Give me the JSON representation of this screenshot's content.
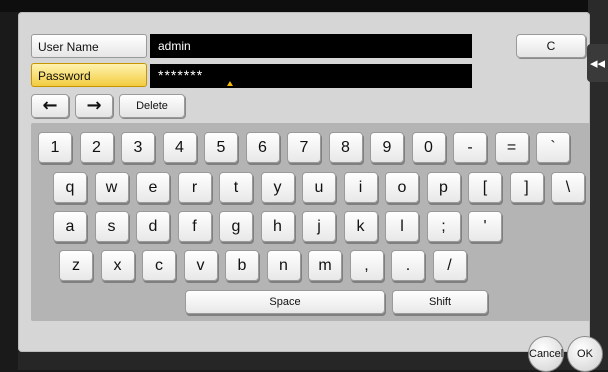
{
  "form": {
    "username_label": "User Name",
    "username_value": "admin",
    "password_label": "Password",
    "password_value": "*******",
    "clear_label": "C"
  },
  "side_tab": {
    "icon": "double-chevron-left-icon",
    "glyph": "◂◂"
  },
  "edit": {
    "left_glyph": "←",
    "right_glyph": "→",
    "delete_label": "Delete"
  },
  "keyboard": {
    "rows": [
      [
        "1",
        "2",
        "3",
        "4",
        "5",
        "6",
        "7",
        "8",
        "9",
        "0",
        "-",
        "=",
        "`"
      ],
      [
        "q",
        "w",
        "e",
        "r",
        "t",
        "y",
        "u",
        "i",
        "o",
        "p",
        "[",
        "]",
        "\\"
      ],
      [
        "a",
        "s",
        "d",
        "f",
        "g",
        "h",
        "j",
        "k",
        "l",
        ";",
        "'"
      ],
      [
        "z",
        "x",
        "c",
        "v",
        "b",
        "n",
        "m",
        ",",
        ".",
        "/"
      ]
    ],
    "space_label": "Space",
    "shift_label": "Shift"
  },
  "footer": {
    "cancel_label": "Cancel",
    "ok_label": "OK"
  },
  "colors": {
    "active_field": "#f2cc40",
    "value_background": "#000000",
    "panel": "#d6d6d6"
  }
}
